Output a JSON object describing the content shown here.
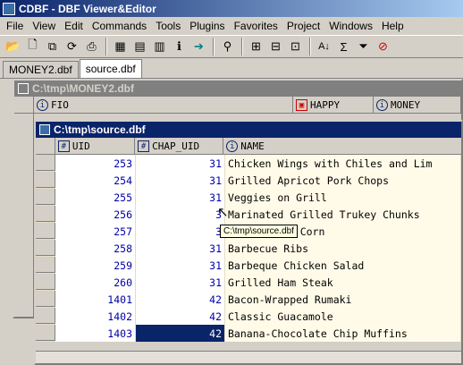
{
  "app": {
    "title": "CDBF - DBF Viewer&Editor"
  },
  "menu": [
    "File",
    "View",
    "Edit",
    "Commands",
    "Tools",
    "Plugins",
    "Favorites",
    "Project",
    "Windows",
    "Help"
  ],
  "toolbar": {
    "icons": [
      "open-folder-icon",
      "new-file-icon",
      "copy-icon",
      "refresh-icon",
      "print-icon",
      "grid-icon",
      "form-icon",
      "table-icon",
      "info-icon",
      "arrow-right-icon",
      "binoculars-icon",
      "add-record-icon",
      "index-icon",
      "index2-icon",
      "sort-az-icon",
      "sum-icon",
      "filter-icon",
      "no-filter-icon"
    ]
  },
  "tabs": [
    {
      "label": "MONEY2.dbf",
      "active": false
    },
    {
      "label": "source.dbf",
      "active": true
    }
  ],
  "money_window": {
    "title": "C:\\tmp\\MONEY2.dbf",
    "columns": [
      "FIO",
      "HAPPY",
      "MONEY"
    ]
  },
  "source_window": {
    "title": "C:\\tmp\\source.dbf",
    "columns": [
      "UID",
      "CHAP_UID",
      "NAME"
    ],
    "rows": [
      {
        "uid": "253",
        "chap": "31",
        "name": "Chicken Wings with Chiles and Lim"
      },
      {
        "uid": "254",
        "chap": "31",
        "name": "Grilled Apricot Pork Chops"
      },
      {
        "uid": "255",
        "chap": "31",
        "name": "Veggies on Grill"
      },
      {
        "uid": "256",
        "chap": "3",
        "name": "Marinated Grilled Trukey Chunks"
      },
      {
        "uid": "257",
        "chap": "3",
        "name": "bed Corn"
      },
      {
        "uid": "258",
        "chap": "31",
        "name": "Barbecue Ribs"
      },
      {
        "uid": "259",
        "chap": "31",
        "name": "Barbeque Chicken Salad"
      },
      {
        "uid": "260",
        "chap": "31",
        "name": "Grilled Ham Steak"
      },
      {
        "uid": "1401",
        "chap": "42",
        "name": "Bacon-Wrapped Rumaki"
      },
      {
        "uid": "1402",
        "chap": "42",
        "name": "Classic Guacamole"
      },
      {
        "uid": "1403",
        "chap": "42",
        "name": "Banana-Chocolate Chip Muffins"
      }
    ],
    "tooltip": "C:\\tmp\\source.dbf"
  }
}
